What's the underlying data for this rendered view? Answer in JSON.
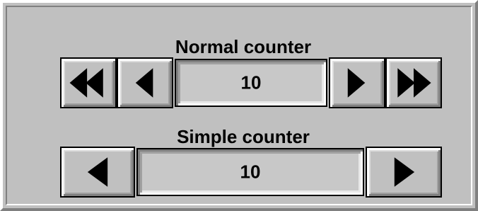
{
  "normal_counter": {
    "title": "Normal counter",
    "value": "10",
    "buttons": {
      "fast_backward_icon": "double-left-triangle-icon",
      "backward_icon": "left-triangle-icon",
      "forward_icon": "right-triangle-icon",
      "fast_forward_icon": "double-right-triangle-icon"
    }
  },
  "simple_counter": {
    "title": "Simple counter",
    "value": "10",
    "buttons": {
      "backward_icon": "left-triangle-icon",
      "forward_icon": "right-triangle-icon"
    }
  },
  "colors": {
    "panel": "#c0c0c0",
    "highlight": "#ffffff",
    "shadow": "#808080",
    "text": "#000000"
  }
}
